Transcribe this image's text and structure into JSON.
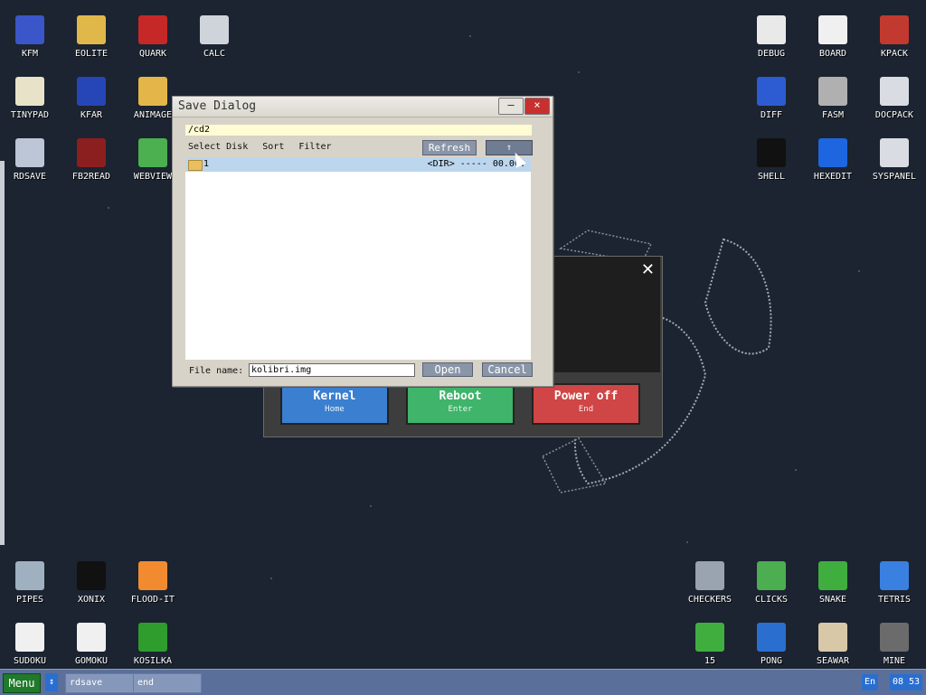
{
  "desktop": {
    "icons": [
      {
        "label": "KFM",
        "icon": "floppy-icon",
        "color": "#3a56c9"
      },
      {
        "label": "EOLITE",
        "icon": "folder-icon",
        "color": "#e0b84a"
      },
      {
        "label": "QUARK",
        "icon": "book-icon",
        "color": "#c62828"
      },
      {
        "label": "CALC",
        "icon": "calculator-icon",
        "color": "#cfd4db"
      },
      {
        "label": "TINYPAD",
        "icon": "notepad-icon",
        "color": "#e8e2c8"
      },
      {
        "label": "KFAR",
        "icon": "kfar-icon",
        "color": "#2646b8"
      },
      {
        "label": "ANIMAGE",
        "icon": "pencil-icon",
        "color": "#e4b64a"
      },
      {
        "label": "RDSAVE",
        "icon": "disk-save-icon",
        "color": "#bcc6d6"
      },
      {
        "label": "FB2READ",
        "icon": "ebook-icon",
        "color": "#8b1f1f"
      },
      {
        "label": "WEBVIEW",
        "icon": "globe-icon",
        "color": "#4caf50"
      },
      {
        "label": "DEBUG",
        "icon": "bug-icon",
        "color": "#e9e9e9"
      },
      {
        "label": "BOARD",
        "icon": "board-icon",
        "color": "#f0f0f0"
      },
      {
        "label": "KPACK",
        "icon": "tools-icon",
        "color": "#c23a2f"
      },
      {
        "label": "DIFF",
        "icon": "diff-icon",
        "color": "#2d5bd1"
      },
      {
        "label": "FASM",
        "icon": "fasm-icon",
        "color": "#b0b0b0"
      },
      {
        "label": "DOCPACK",
        "icon": "cabinet-icon",
        "color": "#d9dde3"
      },
      {
        "label": "SHELL",
        "icon": "terminal-icon",
        "color": "#111111"
      },
      {
        "label": "HEXEDIT",
        "icon": "hex-icon",
        "color": "#1e66e0"
      },
      {
        "label": "SYSPANEL",
        "icon": "sliders-icon",
        "color": "#d9dde3"
      },
      {
        "label": "PIPES",
        "icon": "pipes-icon",
        "color": "#9fb0c0"
      },
      {
        "label": "XONIX",
        "icon": "xonix-icon",
        "color": "#111111"
      },
      {
        "label": "FLOOD-IT",
        "icon": "flood-icon",
        "color": "#f28b30"
      },
      {
        "label": "SUDOKU",
        "icon": "sudoku-icon",
        "color": "#f0f0f0"
      },
      {
        "label": "GOMOKU",
        "icon": "gomoku-icon",
        "color": "#f0f0f0"
      },
      {
        "label": "KOSILKA",
        "icon": "mower-icon",
        "color": "#2e9d2e"
      },
      {
        "label": "CHECKERS",
        "icon": "checkers-icon",
        "color": "#9aa4b0"
      },
      {
        "label": "CLICKS",
        "icon": "blocks-icon",
        "color": "#4cae50"
      },
      {
        "label": "SNAKE",
        "icon": "snake-icon",
        "color": "#3fae3f"
      },
      {
        "label": "TETRIS",
        "icon": "tetris-icon",
        "color": "#3a80e0"
      },
      {
        "label": "15",
        "icon": "grid15-icon",
        "color": "#3fae3f"
      },
      {
        "label": "PONG",
        "icon": "pong-icon",
        "color": "#2a6fd0"
      },
      {
        "label": "SEAWAR",
        "icon": "ship-icon",
        "color": "#d9c8a8"
      },
      {
        "label": "MINE",
        "icon": "mine-icon",
        "color": "#6b6b6b"
      }
    ]
  },
  "save_dialog": {
    "title": "Save Dialog",
    "minimize_symbol": "–",
    "close_symbol": "×",
    "path": "/cd2",
    "menu": {
      "select_disk": "Select Disk",
      "sort": "Sort",
      "filter": "Filter"
    },
    "refresh_label": "Refresh",
    "up_label": "⇑",
    "files": [
      {
        "name": "1",
        "info": "<DIR> ----- 00.00."
      }
    ],
    "filename_label": "File name:",
    "filename_value": "kolibri.img",
    "open_label": "Open",
    "cancel_label": "Cancel"
  },
  "shutdown_dialog": {
    "close_symbol": "✕",
    "buttons": [
      {
        "label": "Kernel",
        "hint": "Home",
        "color": "#3b7fd0"
      },
      {
        "label": "Reboot",
        "hint": "Enter",
        "color": "#3fb46a"
      },
      {
        "label": "Power off",
        "hint": "End",
        "color": "#d04545"
      }
    ]
  },
  "taskbar": {
    "menu_label": "Menu",
    "arrows": "↕",
    "tasks": [
      "rdsave",
      "end"
    ],
    "lang": "En",
    "clock": "08 53"
  }
}
